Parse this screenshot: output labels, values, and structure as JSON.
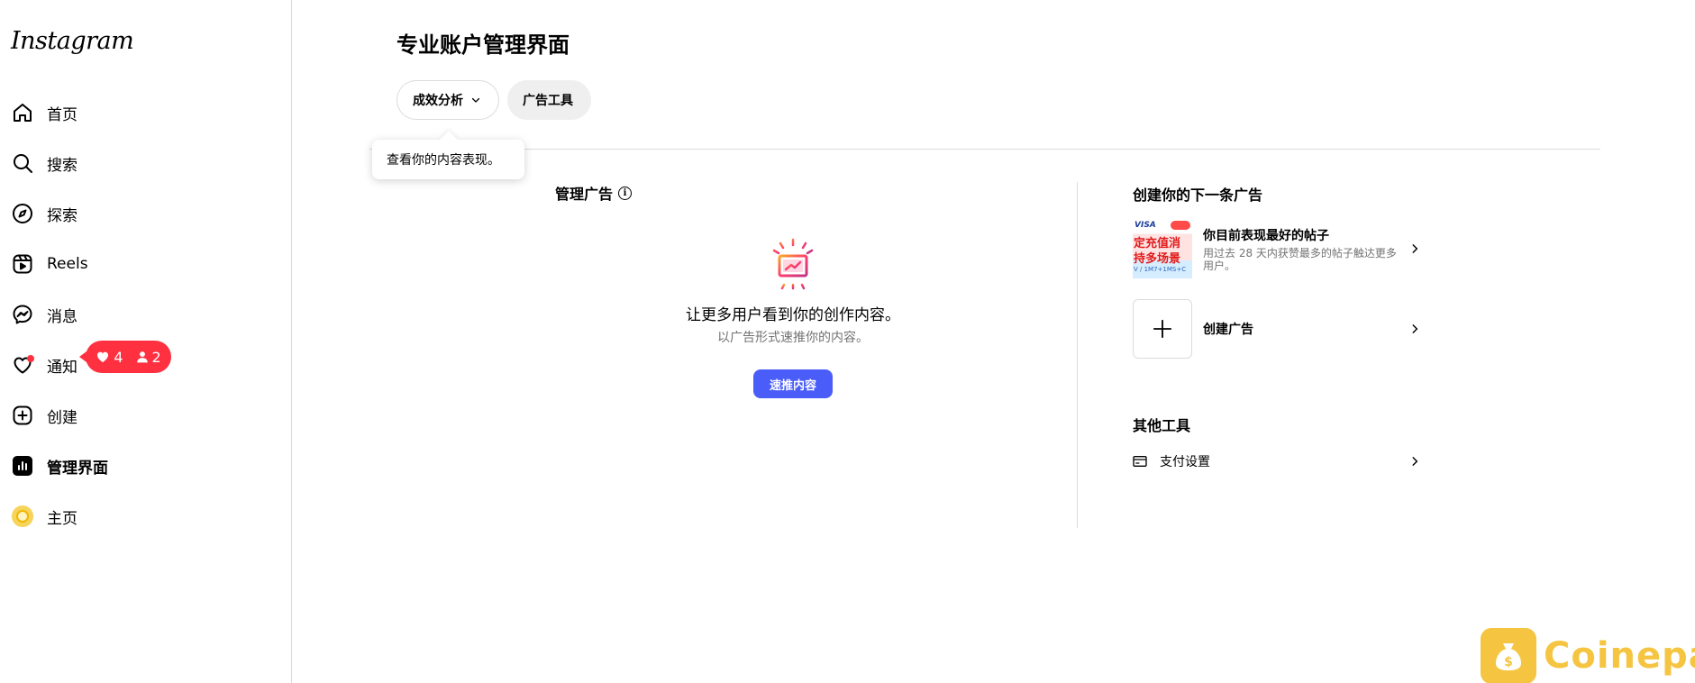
{
  "sidebar": {
    "logo": "Instagram",
    "items": [
      {
        "label": "首页",
        "icon": "home-icon"
      },
      {
        "label": "搜索",
        "icon": "search-icon"
      },
      {
        "label": "探索",
        "icon": "compass-icon"
      },
      {
        "label": "Reels",
        "icon": "reels-icon"
      },
      {
        "label": "消息",
        "icon": "messenger-icon"
      },
      {
        "label": "通知",
        "icon": "heart-icon"
      },
      {
        "label": "创建",
        "icon": "plus-square-icon"
      },
      {
        "label": "管理界面",
        "icon": "dashboard-icon"
      },
      {
        "label": "主页",
        "icon": "avatar"
      }
    ],
    "active_index": 7,
    "notification_badge": {
      "likes": "4",
      "followers": "2"
    }
  },
  "main": {
    "title": "专业账户管理界面",
    "tabs": [
      {
        "label": "成效分析"
      },
      {
        "label": "广告工具"
      }
    ],
    "tooltip": "查看你的内容表现。",
    "manage_ads": {
      "heading": "管理广告",
      "empty_title": "让更多用户看到你的创作内容。",
      "empty_subtitle": "以广告形式速推你的内容。",
      "boost_button": "速推内容"
    },
    "create_next_ad": {
      "heading": "创建你的下一条广告",
      "top_post": {
        "title": "你目前表现最好的帖子",
        "description": "用过去 28 天内获赞最多的帖子触达更多用户。",
        "thumb_texts": [
          "VISA",
          "定充值消",
          "持多场景",
          "V / 1M7+1MS+C"
        ]
      },
      "create_ad_label": "创建广告"
    },
    "other_tools": {
      "heading": "其他工具",
      "payment_label": "支付设置"
    }
  },
  "watermark": {
    "text": "Coinepay"
  },
  "colors": {
    "accent": "#4a5df9",
    "notification": "#ff3040",
    "watermark": "#f5c542"
  }
}
